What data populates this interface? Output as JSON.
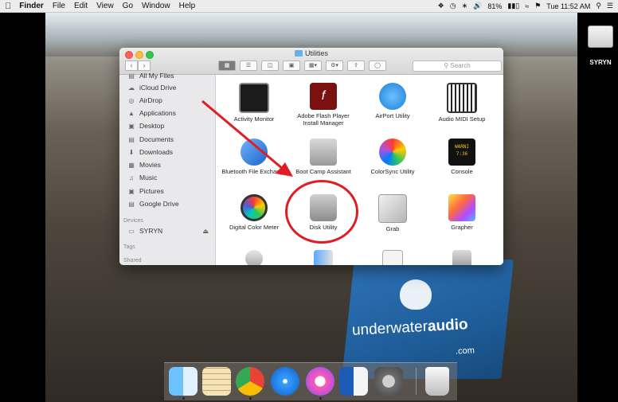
{
  "menubar": {
    "app_name": "Finder",
    "items": [
      "File",
      "Edit",
      "View",
      "Go",
      "Window",
      "Help"
    ],
    "battery": "81%",
    "clock": "Tue 11:52 AM"
  },
  "desktop": {
    "drive_label": "SYRYN",
    "box_brand_left": "underwater",
    "box_brand_right": "audio",
    "box_brand_domain": ".com"
  },
  "window": {
    "title": "Utilities",
    "search_placeholder": "Search"
  },
  "sidebar": {
    "favorites": [
      "All My Files",
      "iCloud Drive",
      "AirDrop",
      "Applications",
      "Desktop",
      "Documents",
      "Downloads",
      "Movies",
      "Music",
      "Pictures",
      "Google Drive"
    ],
    "devices_header": "Devices",
    "device_name": "SYRYN",
    "tags_header": "Tags",
    "shared_header": "Shared"
  },
  "apps": [
    {
      "label": "Activity Monitor"
    },
    {
      "label": "Adobe Flash Player Install Manager"
    },
    {
      "label": "AirPort Utility"
    },
    {
      "label": "Audio MIDI Setup"
    },
    {
      "label": "Bluetooth File Exchange"
    },
    {
      "label": "Boot Camp Assistant"
    },
    {
      "label": "ColorSync Utility"
    },
    {
      "label": "Console"
    },
    {
      "label": "Digital Color Meter"
    },
    {
      "label": "Disk Utility"
    },
    {
      "label": "Grab"
    },
    {
      "label": "Grapher"
    }
  ],
  "colors": {
    "annotation_red": "#e01d25",
    "sidebar_bg": "#e9e9eb"
  }
}
